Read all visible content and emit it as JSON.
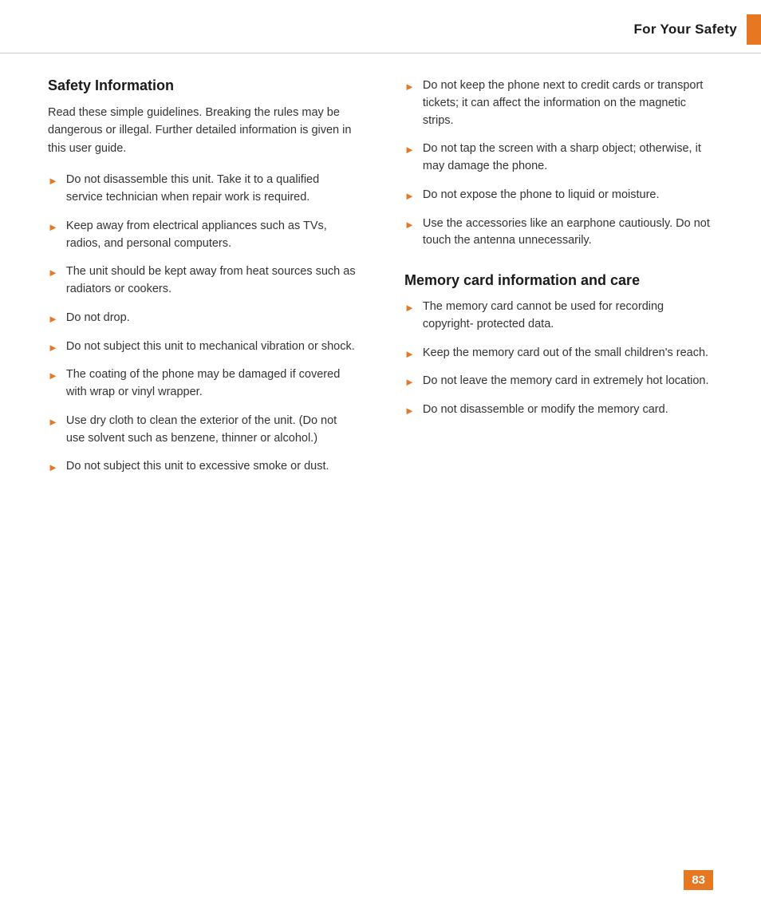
{
  "header": {
    "title": "For Your Safety",
    "accent_color": "#e87722"
  },
  "left_section": {
    "title": "Safety Information",
    "intro": "Read these simple guidelines. Breaking the rules may be dangerous or illegal. Further detailed information is given in this user guide.",
    "bullets": [
      "Do not disassemble this unit. Take it to a qualified service technician when repair work is required.",
      "Keep away from electrical appliances such as TVs, radios, and personal computers.",
      "The unit should be kept away from heat sources such as radiators or cookers.",
      "Do not drop.",
      "Do not subject this unit to mechanical vibration or shock.",
      "The coating of the phone may be damaged if covered with wrap or vinyl wrapper.",
      "Use dry cloth to clean the exterior of the unit. (Do not use solvent such as benzene, thinner or alcohol.)",
      "Do not subject this unit to excessive smoke or dust."
    ]
  },
  "right_section": {
    "top_bullets": [
      "Do not keep the phone next to credit cards or transport tickets; it can affect the information on the magnetic strips.",
      "Do not tap the screen with a sharp object; otherwise, it may damage the phone.",
      "Do not expose the phone to liquid or moisture.",
      "Use the accessories like an earphone cautiously. Do not touch the antenna unnecessarily."
    ],
    "memory_title": "Memory card information and care",
    "memory_bullets": [
      "The memory card cannot be used for recording copyright- protected data.",
      "Keep the memory card out of the small children's reach.",
      "Do not leave the memory card in extremely hot location.",
      "Do not disassemble or modify the memory card."
    ]
  },
  "footer": {
    "page_number": "83"
  },
  "icons": {
    "bullet_arrow": "&#9658;"
  }
}
